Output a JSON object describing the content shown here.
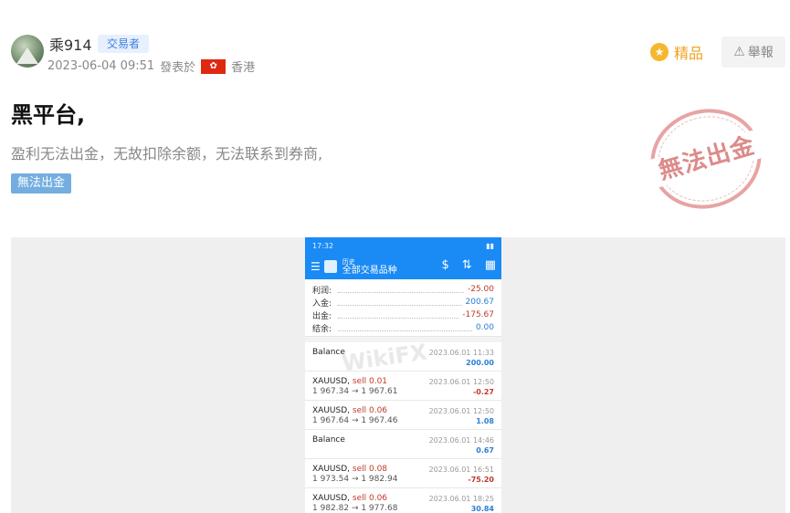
{
  "post": {
    "username": "乘914",
    "role_badge": "交易者",
    "date": "2023-06-04 09:51",
    "posted_from": "發表於",
    "location": "香港",
    "premium_label": "精品",
    "report_label": "舉報",
    "title": "黑平台,",
    "body": "盈利无法出金，无故扣除余额，无法联系到券商,",
    "tag": "無法出金",
    "stamp_text": "無法出金"
  },
  "phone": {
    "status_time": "17:32",
    "app_title_small": "历史",
    "app_title": "全部交易品种",
    "summary": [
      {
        "label": "利润:",
        "value": "-25.00",
        "neg": true
      },
      {
        "label": "入金:",
        "value": "200.67",
        "neg": false
      },
      {
        "label": "出金:",
        "value": "-175.67",
        "neg": true
      },
      {
        "label": "结余:",
        "value": "0.00",
        "neg": false
      }
    ],
    "transactions": [
      {
        "symbol": "Balance",
        "side": "",
        "prices": "",
        "date": "2023.06.01 11:33",
        "profit": "200.00",
        "neg": false
      },
      {
        "symbol": "XAUUSD,",
        "side": "sell 0.01",
        "prices": "1 967.34 → 1 967.61",
        "date": "2023.06.01 12:50",
        "profit": "-0.27",
        "neg": true
      },
      {
        "symbol": "XAUUSD,",
        "side": "sell 0.06",
        "prices": "1 967.64 → 1 967.46",
        "date": "2023.06.01 12:50",
        "profit": "1.08",
        "neg": false
      },
      {
        "symbol": "Balance",
        "side": "",
        "prices": "",
        "date": "2023.06.01 14:46",
        "profit": "0.67",
        "neg": false
      },
      {
        "symbol": "XAUUSD,",
        "side": "sell 0.08",
        "prices": "1 973.54 → 1 982.94",
        "date": "2023.06.01 16:51",
        "profit": "-75.20",
        "neg": true
      },
      {
        "symbol": "XAUUSD,",
        "side": "sell 0.06",
        "prices": "1 982.82 → 1 977.68",
        "date": "2023.06.01 18:25",
        "profit": "30.84",
        "neg": false
      }
    ],
    "watermark": "WikiFX"
  }
}
